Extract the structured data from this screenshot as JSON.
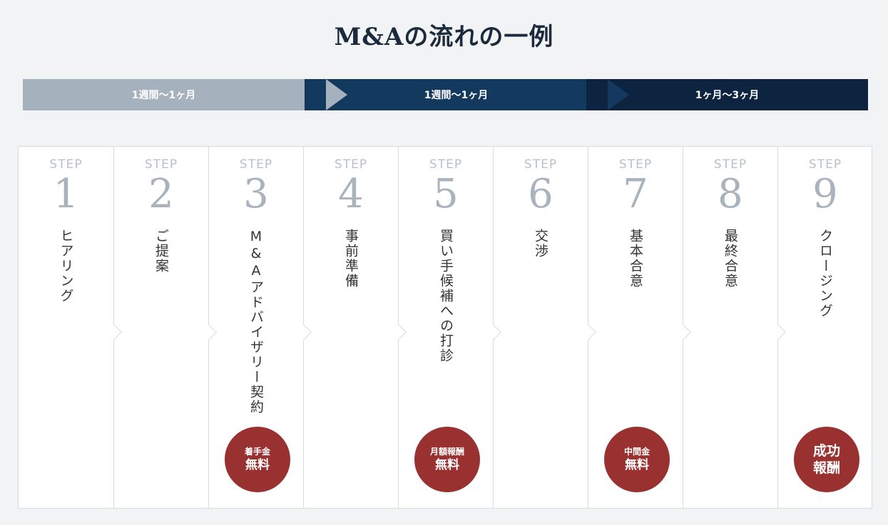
{
  "title": "M&Aの流れの一例",
  "phases": [
    {
      "label": "1週間〜1ヶ月"
    },
    {
      "label": "1週間〜1ヶ月"
    },
    {
      "label": "1ヶ月〜3ヶ月"
    }
  ],
  "step_word": "STEP",
  "steps": [
    {
      "num": "1",
      "label": "ヒアリング"
    },
    {
      "num": "2",
      "label": "ご提案"
    },
    {
      "num": "3",
      "label": "M&Aアドバイザリー契約",
      "badge": {
        "line1": "着手金",
        "line2": "無料"
      }
    },
    {
      "num": "4",
      "label": "事前準備"
    },
    {
      "num": "5",
      "label": "買い手候補への打診",
      "badge": {
        "line1": "月額報酬",
        "line2": "無料"
      }
    },
    {
      "num": "6",
      "label": "交渉"
    },
    {
      "num": "7",
      "label": "基本合意",
      "badge": {
        "line1": "中間金",
        "line2": "無料"
      }
    },
    {
      "num": "8",
      "label": "最終合意"
    },
    {
      "num": "9",
      "label": "クロージング",
      "badge": {
        "line1": "成功",
        "line2": "報酬"
      }
    }
  ],
  "colors": {
    "badge": "#993131",
    "phase1": "#a5b1bd",
    "phase2": "#14395e",
    "phase3": "#0c2440"
  }
}
